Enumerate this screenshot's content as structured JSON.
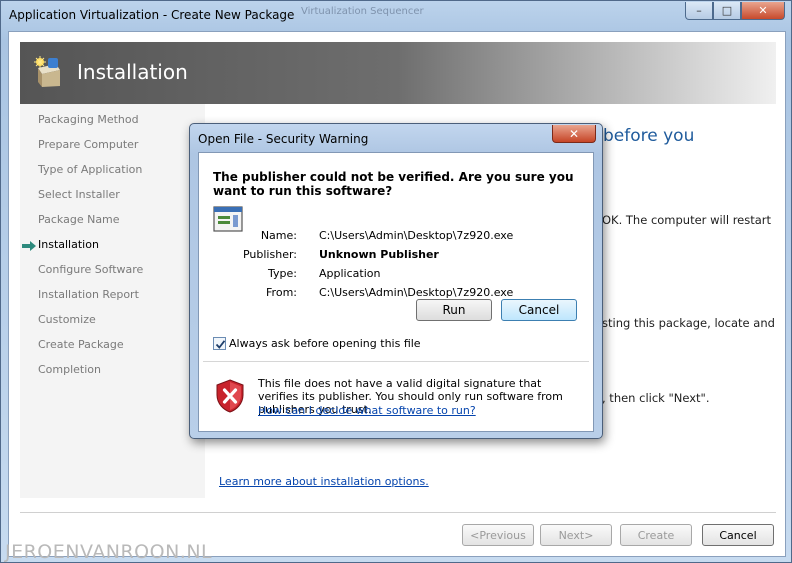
{
  "window": {
    "title": "Application Virtualization - Create New Package",
    "ghost_title": "Virtualization Sequencer",
    "minimize_glyph": "–",
    "restore_glyph": "□",
    "close_glyph": "✕"
  },
  "banner": {
    "title": "Installation",
    "icon": "installer-box-icon"
  },
  "steps": [
    {
      "label": "Packaging Method",
      "active": false
    },
    {
      "label": "Prepare Computer",
      "active": false
    },
    {
      "label": "Type of Application",
      "active": false
    },
    {
      "label": "Select Installer",
      "active": false
    },
    {
      "label": "Package Name",
      "active": false
    },
    {
      "label": "Installation",
      "active": true
    },
    {
      "label": "Configure Software",
      "active": false
    },
    {
      "label": "Installation Report",
      "active": false
    },
    {
      "label": "Customize",
      "active": false
    },
    {
      "label": "Create Package",
      "active": false
    },
    {
      "label": "Completion",
      "active": false
    }
  ],
  "main": {
    "heading_fragment": "before you",
    "text_ok_restart": "OK. The computer will restart",
    "text_locate": "sting this package, locate and",
    "text_next": ", then click \"Next\".",
    "learn_more_link": "Learn more about installation options."
  },
  "wizard_buttons": {
    "previous": "<Previous",
    "next": "Next>",
    "create": "Create",
    "cancel": "Cancel"
  },
  "watermark": "JEROENVANROON.NL",
  "dialog": {
    "title": "Open File - Security Warning",
    "close_glyph": "✕",
    "question": "The publisher could not be verified.  Are you sure you want to run this software?",
    "fields": [
      {
        "label": "Name:",
        "value": "C:\\Users\\Admin\\Desktop\\7z920.exe",
        "bold": false
      },
      {
        "label": "Publisher:",
        "value": "Unknown Publisher",
        "bold": true
      },
      {
        "label": "Type:",
        "value": "Application",
        "bold": false
      },
      {
        "label": "From:",
        "value": "C:\\Users\\Admin\\Desktop\\7z920.exe",
        "bold": false
      }
    ],
    "run_label": "Run",
    "cancel_label": "Cancel",
    "checkbox_label": "Always ask before opening this file",
    "checkbox_checked": true,
    "warning_text": "This file does not have a valid digital signature that verifies its publisher.  You should only run software from publishers you trust.",
    "warning_link": "How can I decide what software to run?"
  },
  "colors": {
    "accent_blue": "#1f5b9c",
    "link": "#0645ad",
    "shield_red": "#c8232c"
  }
}
